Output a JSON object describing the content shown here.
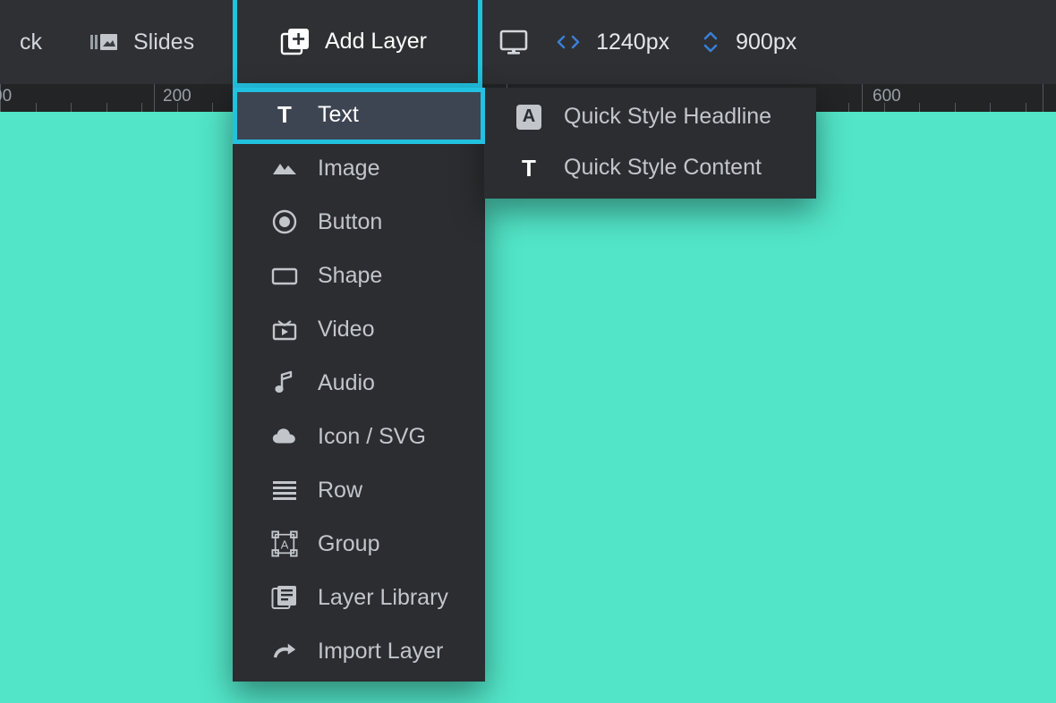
{
  "toolbar": {
    "back_label": "ck",
    "slides_label": "Slides",
    "slides_icon": "slides-filmstrip-icon",
    "add_layer_label": "Add Layer",
    "add_layer_icon": "add-layer-plus-icon",
    "device_icon": "desktop-monitor-icon",
    "width_icon": "horizontal-resize-icon",
    "width_value": "1240px",
    "height_icon": "vertical-resize-icon",
    "height_value": "900px"
  },
  "ruler": {
    "labels": [
      "00",
      "200",
      "600"
    ],
    "unit": "px"
  },
  "menu": {
    "items": [
      {
        "label": "Text",
        "icon": "text-t-icon",
        "active": true,
        "has_submenu": true
      },
      {
        "label": "Image",
        "icon": "image-mountain-icon",
        "active": false,
        "has_submenu": false
      },
      {
        "label": "Button",
        "icon": "button-radio-icon",
        "active": false,
        "has_submenu": false
      },
      {
        "label": "Shape",
        "icon": "shape-rectangle-icon",
        "active": false,
        "has_submenu": false
      },
      {
        "label": "Video",
        "icon": "video-player-icon",
        "active": false,
        "has_submenu": false
      },
      {
        "label": "Audio",
        "icon": "audio-note-icon",
        "active": false,
        "has_submenu": false
      },
      {
        "label": "Icon / SVG",
        "icon": "cloud-icon",
        "active": false,
        "has_submenu": false
      },
      {
        "label": "Row",
        "icon": "row-lines-icon",
        "active": false,
        "has_submenu": false
      },
      {
        "label": "Group",
        "icon": "group-selection-icon",
        "active": false,
        "has_submenu": false
      },
      {
        "label": "Layer Library",
        "icon": "layer-library-icon",
        "active": false,
        "has_submenu": false
      },
      {
        "label": "Import Layer",
        "icon": "import-arrow-icon",
        "active": false,
        "has_submenu": false
      }
    ]
  },
  "submenu": {
    "items": [
      {
        "label": "Quick Style Headline",
        "icon": "headline-a-icon"
      },
      {
        "label": "Quick Style Content",
        "icon": "content-t-icon"
      }
    ]
  },
  "colors": {
    "canvas": "#52e5c8",
    "toolbar_bg": "#2e3033",
    "menu_bg": "#2b2d30",
    "highlight": "#22c1e0",
    "active_item_bg": "#3e4552",
    "ruler_bg": "#222426",
    "accent_blue": "#3b7fd4"
  }
}
